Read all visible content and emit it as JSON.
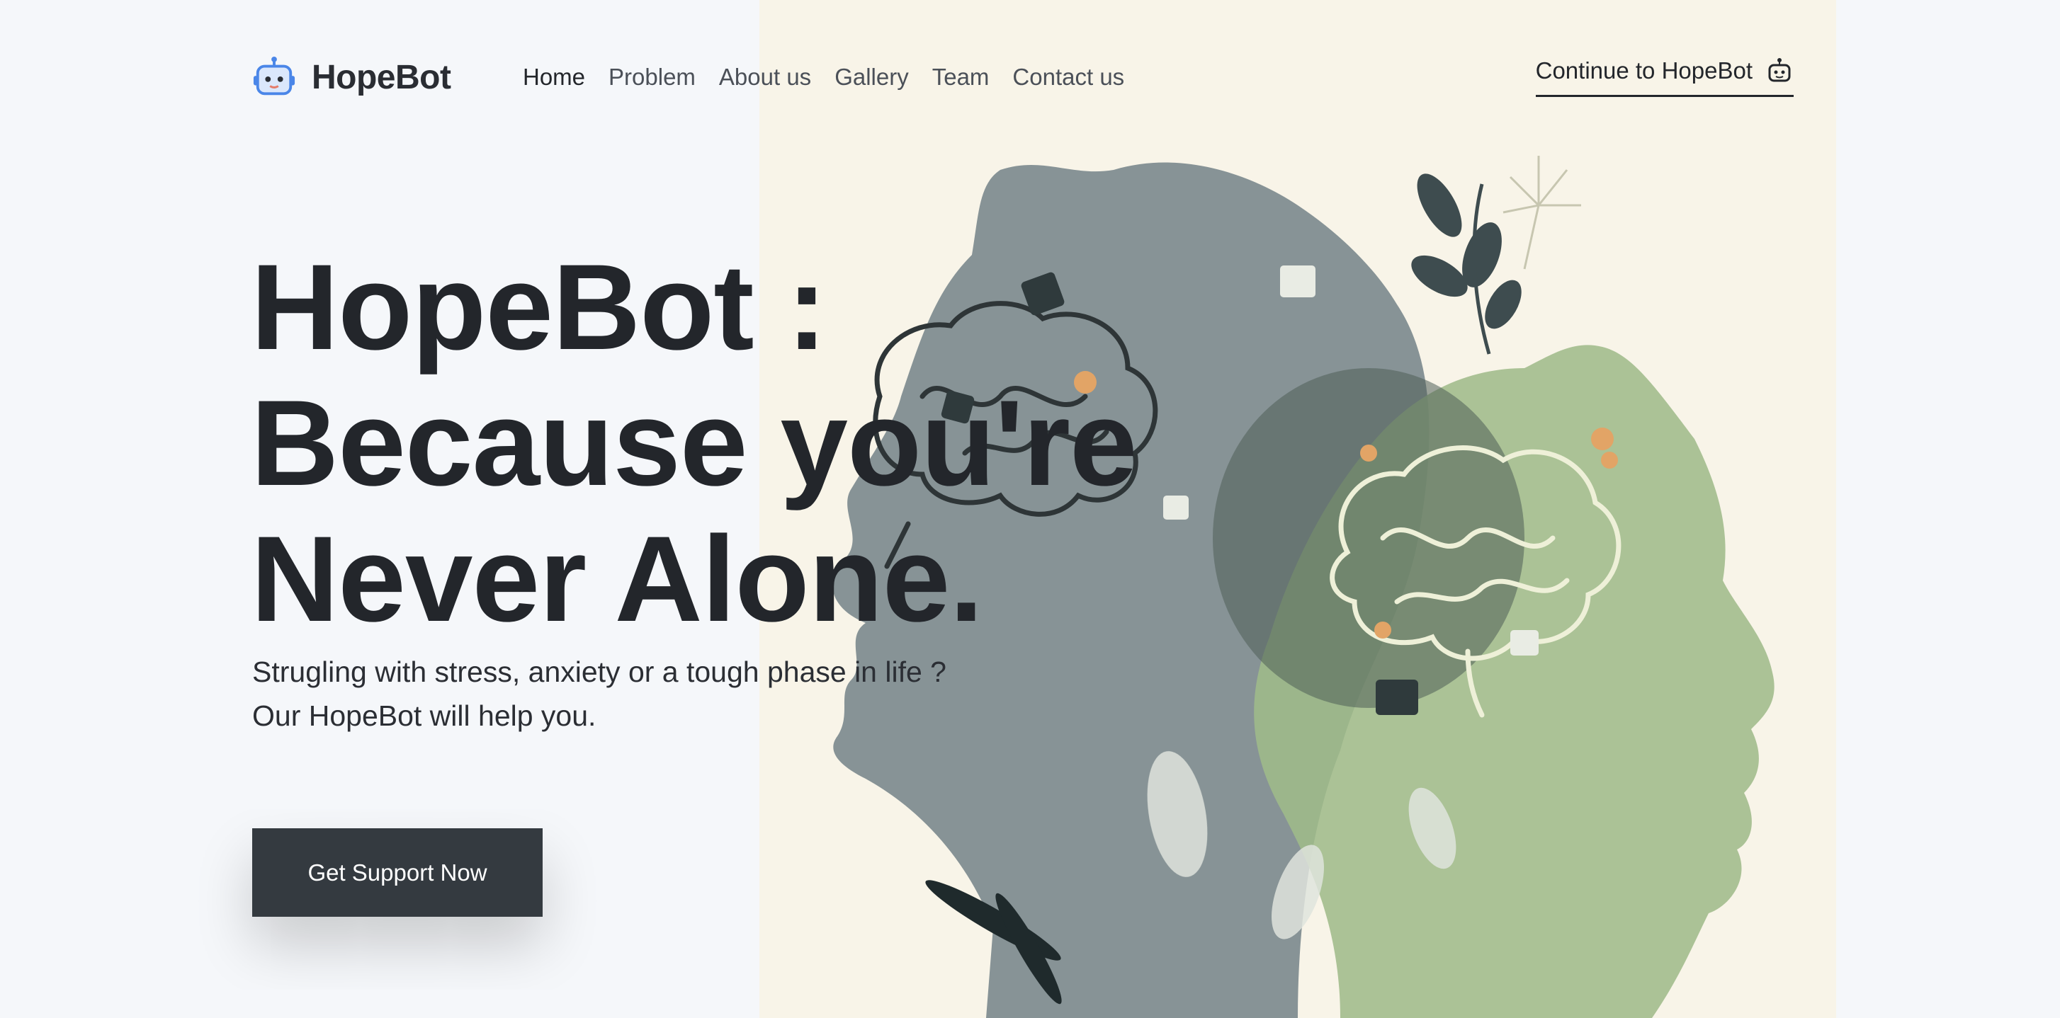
{
  "brand": {
    "name": "HopeBot",
    "icon": "robot-icon",
    "accent_color": "#4a86e8"
  },
  "nav": {
    "links": [
      "Home",
      "Problem",
      "About us",
      "Gallery",
      "Team",
      "Contact us"
    ],
    "active": "Home",
    "cta_label": "Continue to HopeBot",
    "cta_icon": "robot-icon"
  },
  "hero": {
    "headline_lines": [
      "HopeBot :",
      "Because you're",
      "Never Alone."
    ],
    "subtext_lines": [
      "Strugling with stress, anxiety or a tough phase in life ?",
      "Our HopeBot will help you."
    ],
    "button_label": "Get Support Now",
    "button_color": "#343a40",
    "illustration": "two-head-silhouettes-with-brains-illustration"
  },
  "colors": {
    "page_background": "#f5f7fa",
    "illustration_background": "#f8f4e8",
    "silhouette_gray": "#7d8a8e",
    "silhouette_green": "#9fbb8a"
  }
}
